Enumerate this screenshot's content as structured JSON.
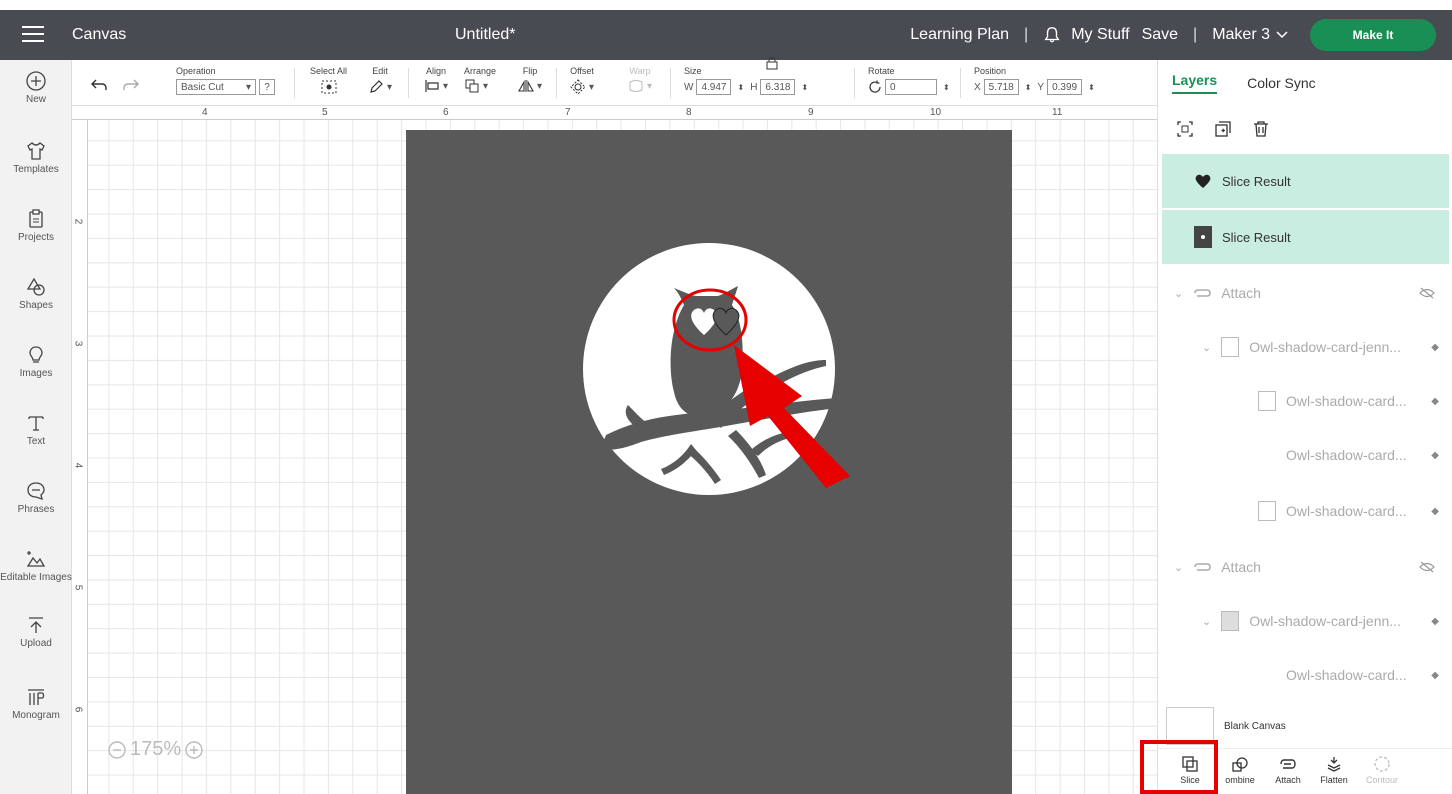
{
  "header": {
    "app_title": "Canvas",
    "doc_title": "Untitled*",
    "learning_plan": "Learning Plan",
    "my_stuff": "My Stuff",
    "save": "Save",
    "machine": "Maker 3",
    "make_it": "Make It"
  },
  "leftnav": {
    "items": [
      {
        "label": "New",
        "icon": "plus-circle-icon"
      },
      {
        "label": "Templates",
        "icon": "shirt-icon"
      },
      {
        "label": "Projects",
        "icon": "clipboard-icon"
      },
      {
        "label": "Shapes",
        "icon": "shapes-icon"
      },
      {
        "label": "Images",
        "icon": "bulb-icon"
      },
      {
        "label": "Text",
        "icon": "text-icon"
      },
      {
        "label": "Phrases",
        "icon": "speech-bubble-icon"
      },
      {
        "label": "Editable Images",
        "icon": "editable-image-icon"
      },
      {
        "label": "Upload",
        "icon": "upload-icon"
      },
      {
        "label": "Monogram",
        "icon": "monogram-icon"
      }
    ]
  },
  "toolbar": {
    "operation_label": "Operation",
    "operation_value": "Basic Cut",
    "help": "?",
    "select_all": "Select All",
    "edit": "Edit",
    "align": "Align",
    "arrange": "Arrange",
    "flip": "Flip",
    "offset": "Offset",
    "warp": "Warp",
    "size_label": "Size",
    "w_label": "W",
    "w_value": "4.947",
    "h_label": "H",
    "h_value": "6.318",
    "rotate_label": "Rotate",
    "rotate_value": "0",
    "position_label": "Position",
    "x_label": "X",
    "x_value": "5.718",
    "y_label": "Y",
    "y_value": "0.399"
  },
  "canvas": {
    "ruler_top": [
      "4",
      "5",
      "6",
      "7",
      "8",
      "9",
      "10",
      "11"
    ],
    "ruler_left": [
      "2",
      "3",
      "4",
      "5",
      "6"
    ],
    "zoom": "175%"
  },
  "rpanel": {
    "tab_layers": "Layers",
    "tab_sync": "Color Sync",
    "layers": [
      {
        "label": "Slice Result"
      },
      {
        "label": "Slice Result"
      },
      {
        "label": "Attach"
      },
      {
        "label": "Owl-shadow-card-jenn..."
      },
      {
        "label": "Owl-shadow-card..."
      },
      {
        "label": "Owl-shadow-card..."
      },
      {
        "label": "Owl-shadow-card..."
      },
      {
        "label": "Attach"
      },
      {
        "label": "Owl-shadow-card-jenn..."
      },
      {
        "label": "Owl-shadow-card..."
      }
    ],
    "blank_canvas": "Blank Canvas",
    "actions": {
      "slice": "Slice",
      "combine": "ombine",
      "attach": "Attach",
      "flatten": "Flatten",
      "contour": "Contour"
    }
  },
  "colors": {
    "accent": "#1a8f55",
    "topbar": "#484c52",
    "mat": "#595959",
    "highlight": "#e60000",
    "selected_layer": "#c9ede0"
  }
}
